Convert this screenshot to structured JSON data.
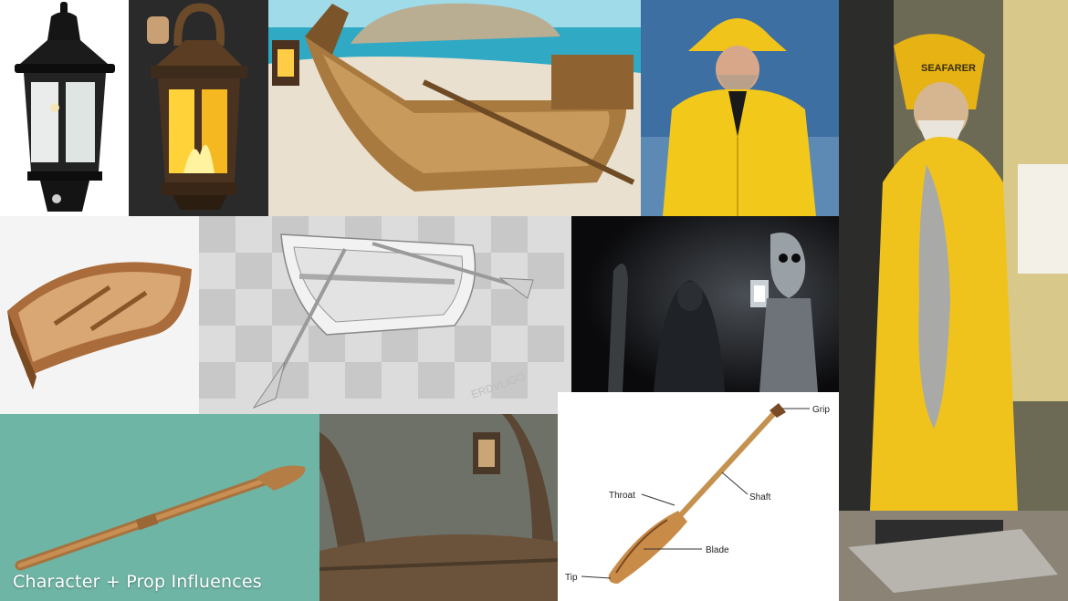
{
  "caption": "Character + Prop Influences",
  "statue_hat_text": "SEAFARER",
  "watermark_text": "ERDVLIGO",
  "paddle_labels": {
    "grip": "Grip",
    "shaft": "Shaft",
    "throat": "Throat",
    "blade": "Blade",
    "tip": "Tip"
  },
  "colors": {
    "slicker_yellow": "#f2c81a",
    "wood": "#b07a3e",
    "teal_bg": "#6fb5a6",
    "lantern_glow": "#ffd23a"
  }
}
